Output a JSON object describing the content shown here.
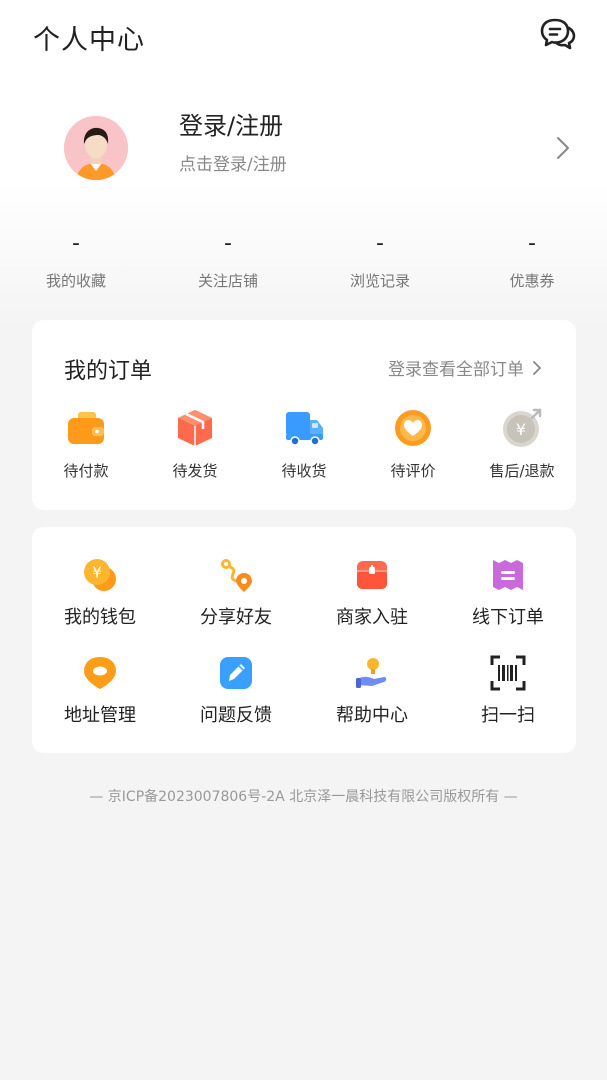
{
  "header": {
    "title": "个人中心"
  },
  "profile": {
    "title": "登录/注册",
    "subtitle": "点击登录/注册"
  },
  "stats": [
    {
      "value": "-",
      "label": "我的收藏"
    },
    {
      "value": "-",
      "label": "关注店铺"
    },
    {
      "value": "-",
      "label": "浏览记录"
    },
    {
      "value": "-",
      "label": "优惠券"
    }
  ],
  "orders": {
    "title": "我的订单",
    "link": "登录查看全部订单",
    "items": [
      {
        "label": "待付款",
        "icon": "wallet-icon"
      },
      {
        "label": "待发货",
        "icon": "package-icon"
      },
      {
        "label": "待收货",
        "icon": "truck-icon"
      },
      {
        "label": "待评价",
        "icon": "heart-icon"
      },
      {
        "label": "售后/退款",
        "icon": "refund-icon"
      }
    ]
  },
  "services": [
    {
      "label": "我的钱包",
      "icon": "coin-wallet-icon"
    },
    {
      "label": "分享好友",
      "icon": "share-route-icon"
    },
    {
      "label": "商家入驻",
      "icon": "shop-icon"
    },
    {
      "label": "线下订单",
      "icon": "ticket-icon"
    },
    {
      "label": "地址管理",
      "icon": "location-icon"
    },
    {
      "label": "问题反馈",
      "icon": "edit-icon"
    },
    {
      "label": "帮助中心",
      "icon": "help-icon"
    },
    {
      "label": "扫一扫",
      "icon": "barcode-scan-icon"
    }
  ],
  "footer": "— 京ICP备2023007806号-2A 北京泽一晨科技有限公司版权所有 —",
  "colors": {
    "accent": "#ff9b1a",
    "background": "#f4f4f5"
  }
}
